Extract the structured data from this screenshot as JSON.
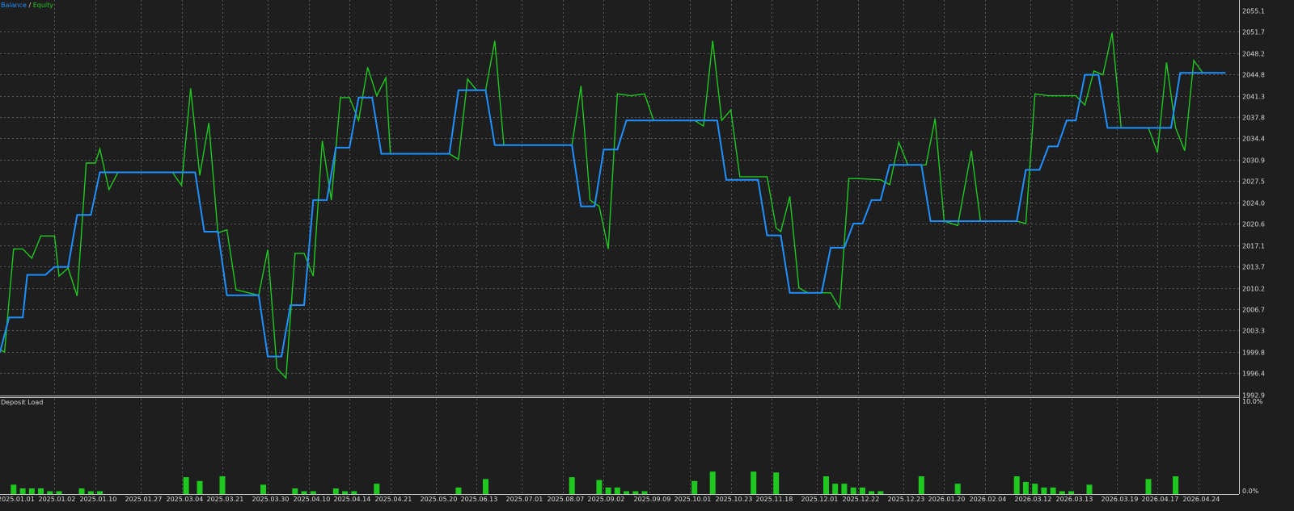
{
  "colors": {
    "background": "#1e1e1e",
    "balance": "#1e90ff",
    "equity": "#1ec81e",
    "deposit_load": "#1ec81e",
    "grid": "#5a5a5a",
    "text": "#d8d8d8"
  },
  "chart_data": [
    {
      "type": "line",
      "legend_position": "top-left",
      "legend": {
        "balance": "Balance",
        "separator": " / ",
        "equity": "Equity"
      },
      "grid": true,
      "ylim": [
        1992.9,
        2055.1
      ],
      "yticks": [
        "2055.1",
        "2051.7",
        "2048.2",
        "2044.8",
        "2041.3",
        "2037.8",
        "2034.4",
        "2030.9",
        "2027.5",
        "2024.0",
        "2020.6",
        "2017.1",
        "2013.7",
        "2010.2",
        "2006.7",
        "2003.3",
        "1999.8",
        "1996.4",
        "1992.9"
      ],
      "x_count": 272,
      "series": [
        {
          "name": "Balance",
          "points": [
            [
              0,
              1999.8
            ],
            [
              2,
              2005.4
            ],
            [
              5,
              2005.4
            ],
            [
              6,
              2012.3
            ],
            [
              10,
              2012.3
            ],
            [
              12,
              2013.6
            ],
            [
              15,
              2013.6
            ],
            [
              17,
              2022.0
            ],
            [
              20,
              2022.0
            ],
            [
              22,
              2028.9
            ],
            [
              43,
              2028.9
            ],
            [
              45,
              2019.3
            ],
            [
              48,
              2019.3
            ],
            [
              50,
              2009.0
            ],
            [
              57,
              2009.0
            ],
            [
              59,
              1999.1
            ],
            [
              62,
              1999.1
            ],
            [
              64,
              2007.4
            ],
            [
              67,
              2007.4
            ],
            [
              69,
              2024.4
            ],
            [
              72,
              2024.4
            ],
            [
              74,
              2032.9
            ],
            [
              77,
              2032.9
            ],
            [
              79,
              2041.0
            ],
            [
              82,
              2041.0
            ],
            [
              84,
              2031.9
            ],
            [
              99,
              2031.9
            ],
            [
              101,
              2042.2
            ],
            [
              107,
              2042.2
            ],
            [
              109,
              2033.3
            ],
            [
              126,
              2033.3
            ],
            [
              128,
              2023.4
            ],
            [
              131,
              2023.4
            ],
            [
              133,
              2032.6
            ],
            [
              136,
              2032.6
            ],
            [
              138,
              2037.3
            ],
            [
              158,
              2037.3
            ],
            [
              160,
              2027.7
            ],
            [
              167,
              2027.7
            ],
            [
              169,
              2018.7
            ],
            [
              172,
              2018.7
            ],
            [
              174,
              2009.4
            ],
            [
              181,
              2009.4
            ],
            [
              183,
              2016.7
            ],
            [
              186,
              2016.7
            ],
            [
              188,
              2020.6
            ],
            [
              190,
              2020.6
            ],
            [
              192,
              2024.4
            ],
            [
              194,
              2024.4
            ],
            [
              196,
              2030.1
            ],
            [
              203,
              2030.1
            ],
            [
              205,
              2021.0
            ],
            [
              224,
              2021.0
            ],
            [
              226,
              2029.3
            ],
            [
              229,
              2029.3
            ],
            [
              231,
              2033.1
            ],
            [
              233,
              2033.1
            ],
            [
              235,
              2037.3
            ],
            [
              237,
              2037.3
            ],
            [
              239,
              2044.7
            ],
            [
              242,
              2044.7
            ],
            [
              244,
              2036.1
            ],
            [
              258,
              2036.1
            ],
            [
              260,
              2045.0
            ],
            [
              270,
              2045.0
            ]
          ]
        },
        {
          "name": "Equity",
          "points": [
            [
              0,
              2000.2
            ],
            [
              1,
              1999.8
            ],
            [
              3,
              2016.5
            ],
            [
              5,
              2016.5
            ],
            [
              7,
              2015.0
            ],
            [
              9,
              2018.6
            ],
            [
              12,
              2018.6
            ],
            [
              13,
              2012.1
            ],
            [
              15,
              2013.4
            ],
            [
              17,
              2008.9
            ],
            [
              19,
              2030.4
            ],
            [
              21,
              2030.4
            ],
            [
              22,
              2032.7
            ],
            [
              24,
              2026.1
            ],
            [
              26,
              2028.9
            ],
            [
              38,
              2028.9
            ],
            [
              40,
              2026.8
            ],
            [
              42,
              2042.5
            ],
            [
              44,
              2028.4
            ],
            [
              46,
              2036.9
            ],
            [
              48,
              2019.1
            ],
            [
              50,
              2019.6
            ],
            [
              52,
              2009.9
            ],
            [
              57,
              2009.0
            ],
            [
              59,
              2016.4
            ],
            [
              61,
              1997.2
            ],
            [
              63,
              1995.6
            ],
            [
              65,
              2015.8
            ],
            [
              67,
              2015.8
            ],
            [
              69,
              2012.1
            ],
            [
              71,
              2034.0
            ],
            [
              73,
              2024.4
            ],
            [
              75,
              2041.0
            ],
            [
              77,
              2041.0
            ],
            [
              79,
              2037.3
            ],
            [
              81,
              2045.9
            ],
            [
              83,
              2041.3
            ],
            [
              85,
              2044.2
            ],
            [
              86,
              2031.9
            ],
            [
              99,
              2031.9
            ],
            [
              101,
              2031.0
            ],
            [
              103,
              2044.0
            ],
            [
              105,
              2042.2
            ],
            [
              107,
              2042.2
            ],
            [
              109,
              2050.2
            ],
            [
              111,
              2033.3
            ],
            [
              126,
              2033.3
            ],
            [
              128,
              2042.9
            ],
            [
              130,
              2024.4
            ],
            [
              132,
              2023.4
            ],
            [
              134,
              2016.5
            ],
            [
              136,
              2041.6
            ],
            [
              139,
              2041.3
            ],
            [
              142,
              2041.6
            ],
            [
              144,
              2037.3
            ],
            [
              153,
              2037.3
            ],
            [
              155,
              2036.4
            ],
            [
              157,
              2050.2
            ],
            [
              159,
              2037.3
            ],
            [
              161,
              2039.0
            ],
            [
              163,
              2028.2
            ],
            [
              169,
              2028.2
            ],
            [
              171,
              2019.9
            ],
            [
              172,
              2019.3
            ],
            [
              174,
              2025.0
            ],
            [
              176,
              2010.2
            ],
            [
              178,
              2009.4
            ],
            [
              183,
              2009.4
            ],
            [
              185,
              2006.9
            ],
            [
              187,
              2027.9
            ],
            [
              189,
              2027.9
            ],
            [
              194,
              2027.7
            ],
            [
              196,
              2026.9
            ],
            [
              198,
              2033.8
            ],
            [
              200,
              2030.1
            ],
            [
              204,
              2030.1
            ],
            [
              206,
              2037.6
            ],
            [
              208,
              2021.0
            ],
            [
              211,
              2020.3
            ],
            [
              214,
              2032.4
            ],
            [
              216,
              2021.0
            ],
            [
              224,
              2021.0
            ],
            [
              226,
              2020.6
            ],
            [
              228,
              2041.6
            ],
            [
              231,
              2041.3
            ],
            [
              237,
              2041.3
            ],
            [
              239,
              2039.8
            ],
            [
              241,
              2045.3
            ],
            [
              243,
              2044.7
            ],
            [
              245,
              2051.5
            ],
            [
              247,
              2036.1
            ],
            [
              253,
              2036.1
            ],
            [
              255,
              2032.1
            ],
            [
              257,
              2046.7
            ],
            [
              259,
              2036.1
            ],
            [
              261,
              2032.4
            ],
            [
              263,
              2047.0
            ],
            [
              265,
              2045.0
            ],
            [
              270,
              2045.0
            ]
          ]
        }
      ],
      "x_tick_labels": [
        {
          "label": "2025.01.01",
          "at": 0
        },
        {
          "label": "2025.01.02",
          "at": 12
        },
        {
          "label": "2025.01.10",
          "at": 21
        },
        {
          "label": "2025.01.27",
          "at": 31
        },
        {
          "label": "2025.03.04",
          "at": 40
        },
        {
          "label": "2025.03.21",
          "at": 49
        },
        {
          "label": "2025.03.30",
          "at": 59
        },
        {
          "label": "2025.04.10",
          "at": 68
        },
        {
          "label": "2025.04.14",
          "at": 77
        },
        {
          "label": "2025.04.21",
          "at": 86
        },
        {
          "label": "2025.05.20",
          "at": 96
        },
        {
          "label": "2025.06.13",
          "at": 105
        },
        {
          "label": "2025.07.01",
          "at": 115
        },
        {
          "label": "2025.08.07",
          "at": 124
        },
        {
          "label": "2025.09.02",
          "at": 133
        },
        {
          "label": "2025.09.09",
          "at": 143
        },
        {
          "label": "2025.10.01",
          "at": 152
        },
        {
          "label": "2025.10.23",
          "at": 161
        },
        {
          "label": "2025.11.18",
          "at": 170
        },
        {
          "label": "2025.12.01",
          "at": 180
        },
        {
          "label": "2025.12.22",
          "at": 189
        },
        {
          "label": "2025.12.23",
          "at": 199
        },
        {
          "label": "2026.01.20",
          "at": 208
        },
        {
          "label": "2026.02.04",
          "at": 217
        },
        {
          "label": "2026.03.12",
          "at": 227
        },
        {
          "label": "2026.03.13",
          "at": 236
        },
        {
          "label": "2026.03.19",
          "at": 246
        },
        {
          "label": "2026.04.17",
          "at": 255
        },
        {
          "label": "2026.04.24",
          "at": 264
        }
      ]
    },
    {
      "type": "bar",
      "title": "Deposit Load",
      "ylim": [
        0.0,
        10.0
      ],
      "yticks": [
        "10.0%",
        "0.0%"
      ],
      "bars": [
        [
          3,
          1.0
        ],
        [
          5,
          0.6
        ],
        [
          7,
          0.6
        ],
        [
          9,
          0.6
        ],
        [
          11,
          0.3
        ],
        [
          13,
          0.3
        ],
        [
          18,
          0.6
        ],
        [
          20,
          0.3
        ],
        [
          22,
          0.3
        ],
        [
          41,
          1.8
        ],
        [
          44,
          1.4
        ],
        [
          49,
          1.9
        ],
        [
          58,
          1.0
        ],
        [
          65,
          0.6
        ],
        [
          67,
          0.3
        ],
        [
          69,
          0.3
        ],
        [
          74,
          0.6
        ],
        [
          76,
          0.3
        ],
        [
          78,
          0.3
        ],
        [
          83,
          1.1
        ],
        [
          101,
          0.7
        ],
        [
          107,
          1.6
        ],
        [
          126,
          1.8
        ],
        [
          132,
          1.5
        ],
        [
          134,
          0.7
        ],
        [
          136,
          0.7
        ],
        [
          138,
          0.3
        ],
        [
          140,
          0.3
        ],
        [
          142,
          0.3
        ],
        [
          153,
          1.4
        ],
        [
          157,
          2.4
        ],
        [
          166,
          2.4
        ],
        [
          171,
          2.3
        ],
        [
          182,
          1.9
        ],
        [
          184,
          1.1
        ],
        [
          186,
          1.1
        ],
        [
          188,
          0.7
        ],
        [
          190,
          0.7
        ],
        [
          192,
          0.3
        ],
        [
          194,
          0.3
        ],
        [
          203,
          1.9
        ],
        [
          211,
          1.1
        ],
        [
          224,
          1.9
        ],
        [
          226,
          1.3
        ],
        [
          228,
          1.1
        ],
        [
          230,
          0.7
        ],
        [
          232,
          0.7
        ],
        [
          234,
          0.3
        ],
        [
          236,
          0.3
        ],
        [
          240,
          1.0
        ],
        [
          253,
          1.6
        ],
        [
          259,
          1.9
        ]
      ]
    }
  ]
}
